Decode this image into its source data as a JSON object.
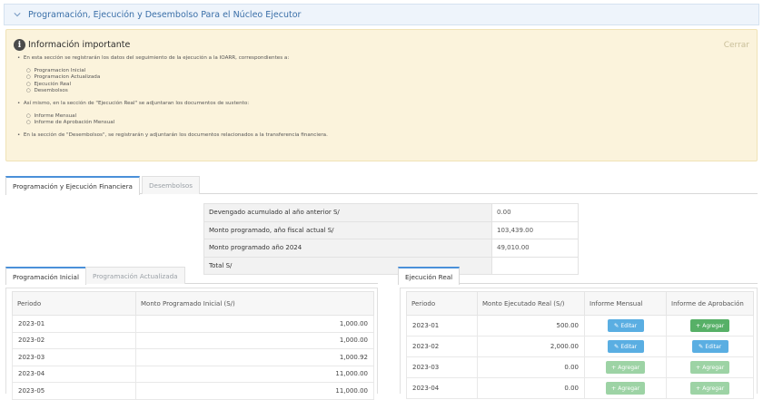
{
  "section": {
    "title": "Programación, Ejecución y Desembolso Para el Núcleo Ejecutor"
  },
  "alert": {
    "title": "Información importante",
    "close": "Cerrar",
    "line1": "En esta sección se registrarán los datos del seguimiento de la ejecución a la IOARR, correspondientes a:",
    "items1": [
      "Programacion Inicial",
      "Programacion Actualizada",
      "Ejecución Real",
      "Desembolsos"
    ],
    "line2": "Así mismo, en la sección de \"Ejecución Real\" se adjuntaran los documentos de sustento:",
    "items2": [
      "Informe Mensual",
      "Informe de Aprobación Mensual"
    ],
    "line3": "En la sección de \"Desembolsos\", se registrarán y adjuntarán los documentos relacionados a la transferencia financiera."
  },
  "tabs_main": [
    "Programación y Ejecución Financiera",
    "Desembolsos"
  ],
  "summary": [
    {
      "label": "Devengado acumulado al año anterior S/",
      "value": "0.00"
    },
    {
      "label": "Monto programado, año fiscal actual S/",
      "value": "103,439.00"
    },
    {
      "label": "Monto programado año 2024",
      "value": "49,010.00"
    },
    {
      "label": "Total S/",
      "value": ""
    }
  ],
  "tabs_left": [
    "Programación Inicial",
    "Programación Actualizada"
  ],
  "tabs_right": [
    "Ejecución Real"
  ],
  "left_table": {
    "headers": [
      "Periodo",
      "Monto Programado Inicial (S/)"
    ],
    "rows": [
      [
        "2023-01",
        "1,000.00"
      ],
      [
        "2023-02",
        "1,000.00"
      ],
      [
        "2023-03",
        "1,000.92"
      ],
      [
        "2023-04",
        "11,000.00"
      ],
      [
        "2023-05",
        "11,000.00"
      ]
    ]
  },
  "right_table": {
    "headers": [
      "Periodo",
      "Monto Ejecutado Real (S/)",
      "Informe Mensual",
      "Informe de Aprobación"
    ],
    "rows": [
      {
        "period": "2023-01",
        "amount": "500.00",
        "mensual": "Editar",
        "aprobacion": "Agregar"
      },
      {
        "period": "2023-02",
        "amount": "2,000.00",
        "mensual": "Editar",
        "aprobacion": "Editar"
      },
      {
        "period": "2023-03",
        "amount": "0.00",
        "mensual": "Agregar",
        "aprobacion": "Agregar"
      },
      {
        "period": "2023-04",
        "amount": "0.00",
        "mensual": "Agregar",
        "aprobacion": "Agregar"
      }
    ]
  },
  "colors": {
    "accent": "#4a90d9",
    "edit_button": "#5aaee2",
    "add_button": "#57b067",
    "add_button_disabled": "#9dd3a5",
    "alert_bg": "#fbf3dc"
  }
}
